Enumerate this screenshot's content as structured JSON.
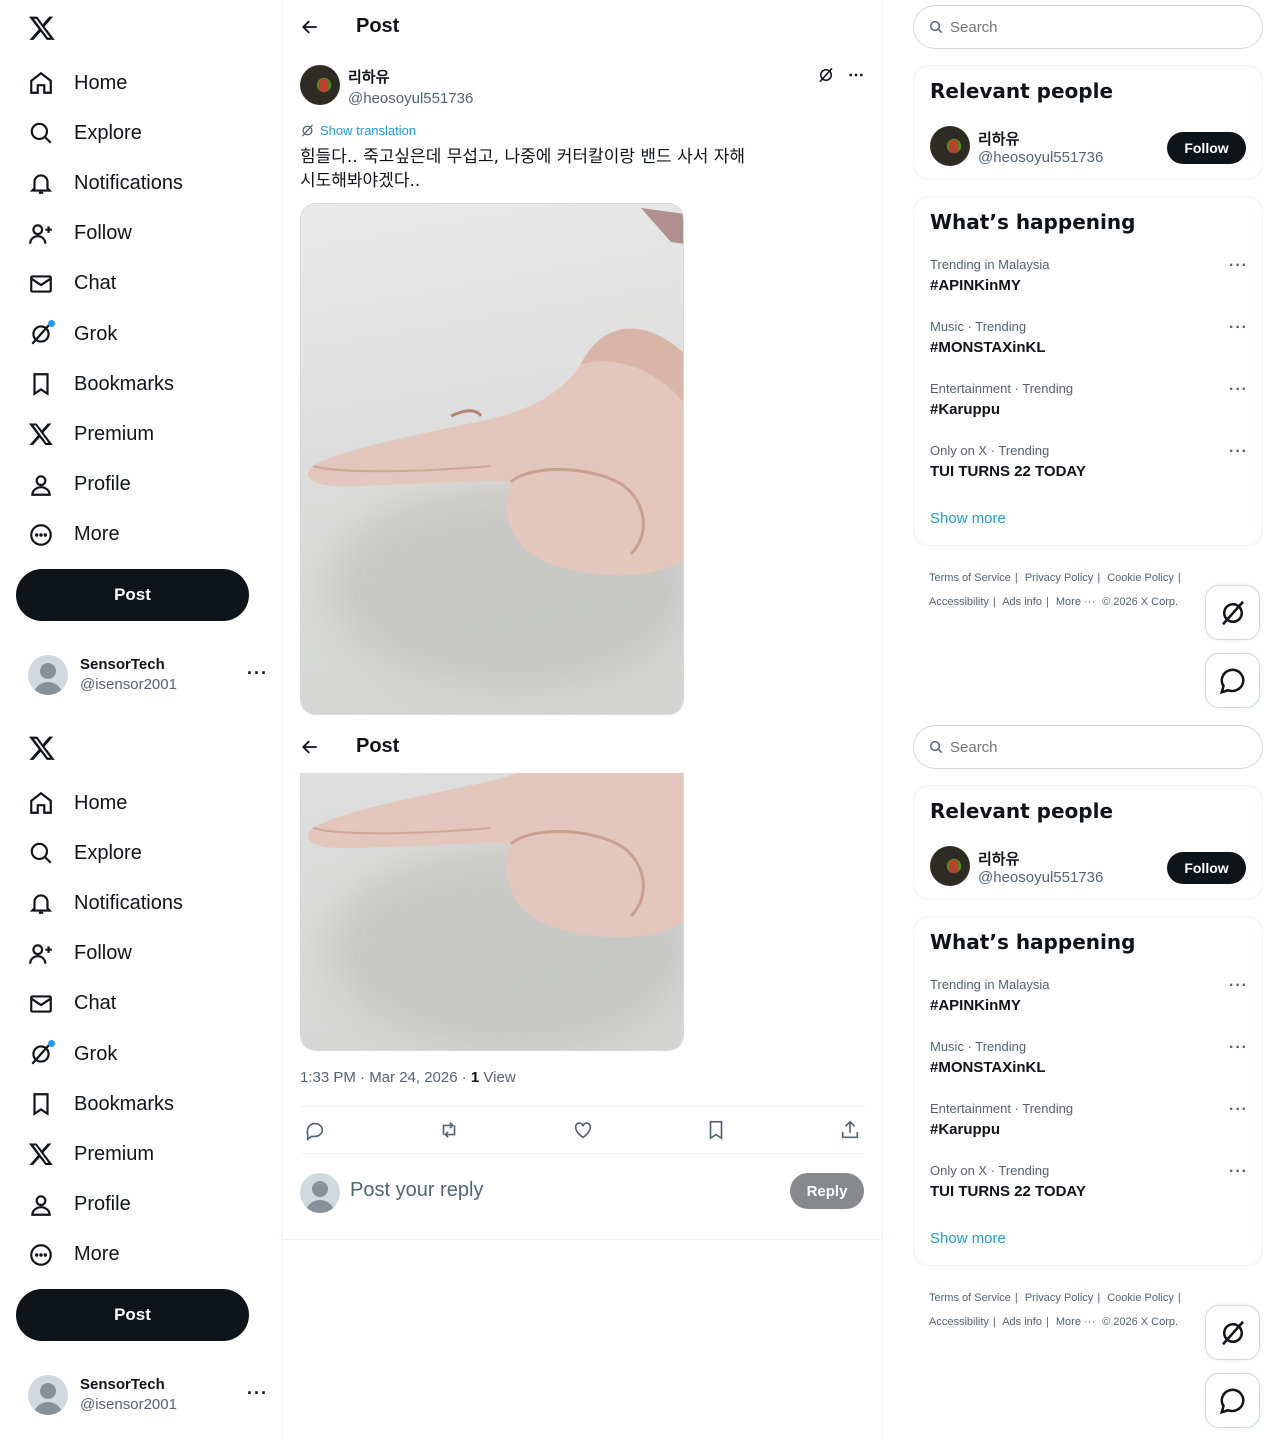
{
  "nav": {
    "items": [
      {
        "label": "Home",
        "icon": "home-icon"
      },
      {
        "label": "Explore",
        "icon": "search-icon"
      },
      {
        "label": "Notifications",
        "icon": "bell-icon"
      },
      {
        "label": "Follow",
        "icon": "person-add-icon"
      },
      {
        "label": "Chat",
        "icon": "mail-icon"
      },
      {
        "label": "Grok",
        "icon": "grok-icon"
      },
      {
        "label": "Bookmarks",
        "icon": "bookmark-icon"
      },
      {
        "label": "Premium",
        "icon": "x-logo-icon"
      },
      {
        "label": "Profile",
        "icon": "person-icon"
      },
      {
        "label": "More",
        "icon": "more-circle-icon"
      }
    ],
    "post_button": "Post"
  },
  "account": {
    "name": "SensorTech",
    "handle": "@isensor2001",
    "more": "···"
  },
  "header": {
    "title": "Post"
  },
  "post": {
    "author_name": "리하유",
    "author_handle": "@heosoyul551736",
    "translate_label": "Show translation",
    "text": "힘들다.. 죽고싶은데 무섭고, 나중에 커터칼이랑 밴드 사서 자해 시도해봐야겠다..",
    "timestamp": "1:33 PM · Mar 24, 2026 · ",
    "views_count": "1",
    "views_label": " View"
  },
  "reply": {
    "placeholder": "Post your reply",
    "button": "Reply"
  },
  "search": {
    "placeholder": "Search"
  },
  "relevant": {
    "title": "Relevant people",
    "name": "리하유",
    "handle": "@heosoyul551736",
    "button": "Follow"
  },
  "happening": {
    "title": "What’s happening",
    "trends": [
      {
        "context": "Trending in Malaysia",
        "title": "#APINKinMY"
      },
      {
        "context": "Music · Trending",
        "title": "#MONSTAXinKL"
      },
      {
        "context": "Entertainment · Trending",
        "title": "#Karuppu"
      },
      {
        "context": "Only on X · Trending",
        "title": "TUI TURNS 22 TODAY"
      }
    ],
    "show_more": "Show more"
  },
  "footer": {
    "links": [
      "Terms of Service",
      "|",
      "Privacy Policy",
      "|",
      "Cookie Policy",
      "|",
      "Accessibility",
      "|",
      "Ads info",
      "|",
      "More ···",
      "© 2026 X Corp."
    ]
  },
  "colors": {
    "accent": "#1d9bf0",
    "text": "#0f1419",
    "muted": "#536471"
  }
}
